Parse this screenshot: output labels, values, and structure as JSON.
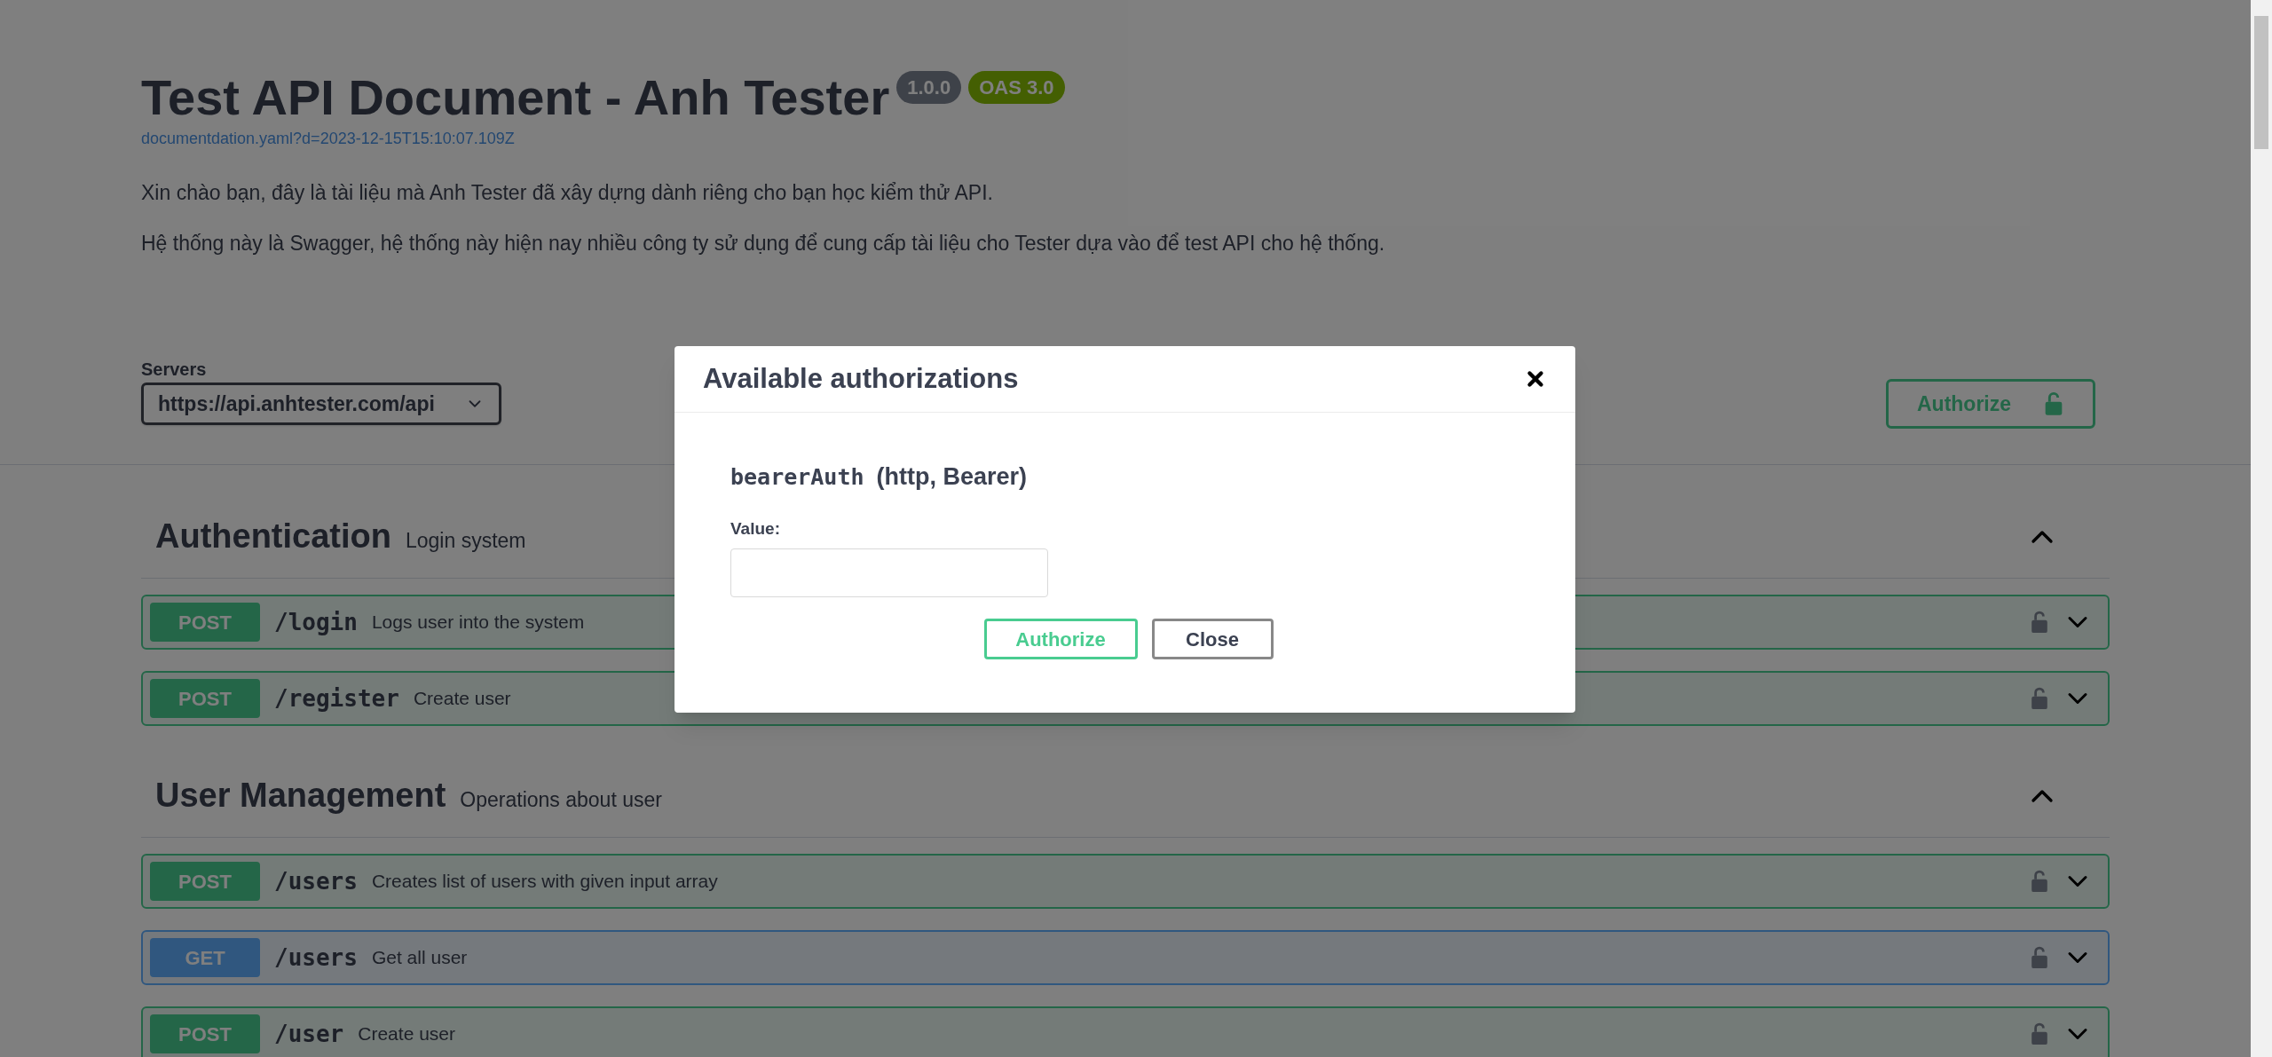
{
  "info": {
    "title": "Test API Document - Anh Tester",
    "version": "1.0.0",
    "oas": "OAS 3.0",
    "url": "documentdation.yaml?d=2023-12-15T15:10:07.109Z",
    "description": [
      "Xin chào bạn, đây là tài liệu mà Anh Tester đã xây dựng dành riêng cho bạn học kiểm thử API.",
      "Hệ thống này là Swagger, hệ thống này hiện nay nhiều công ty sử dụng để cung cấp tài liệu cho Tester dựa vào để test API cho hệ thống."
    ]
  },
  "servers": {
    "label": "Servers",
    "value": "https://api.anhtester.com/api"
  },
  "authorize_button": "Authorize",
  "tags": [
    {
      "name": "Authentication",
      "description": "Login system",
      "expanded": true,
      "operations": [
        {
          "method": "POST",
          "kind": "post",
          "path": "/login",
          "summary": "Logs user into the system"
        },
        {
          "method": "POST",
          "kind": "post",
          "path": "/register",
          "summary": "Create user"
        }
      ]
    },
    {
      "name": "User Management",
      "description": "Operations about user",
      "expanded": true,
      "operations": [
        {
          "method": "POST",
          "kind": "post",
          "path": "/users",
          "summary": "Creates list of users with given input array"
        },
        {
          "method": "GET",
          "kind": "get",
          "path": "/users",
          "summary": "Get all user"
        },
        {
          "method": "POST",
          "kind": "post",
          "path": "/user",
          "summary": "Create user"
        }
      ]
    }
  ],
  "modal": {
    "title": "Available authorizations",
    "scheme_name": "bearerAuth",
    "scheme_type": "(http, Bearer)",
    "value_label": "Value:",
    "buttons": [
      {
        "label": "Authorize",
        "kind": "primary"
      },
      {
        "label": "Close",
        "kind": "secondary"
      }
    ]
  }
}
